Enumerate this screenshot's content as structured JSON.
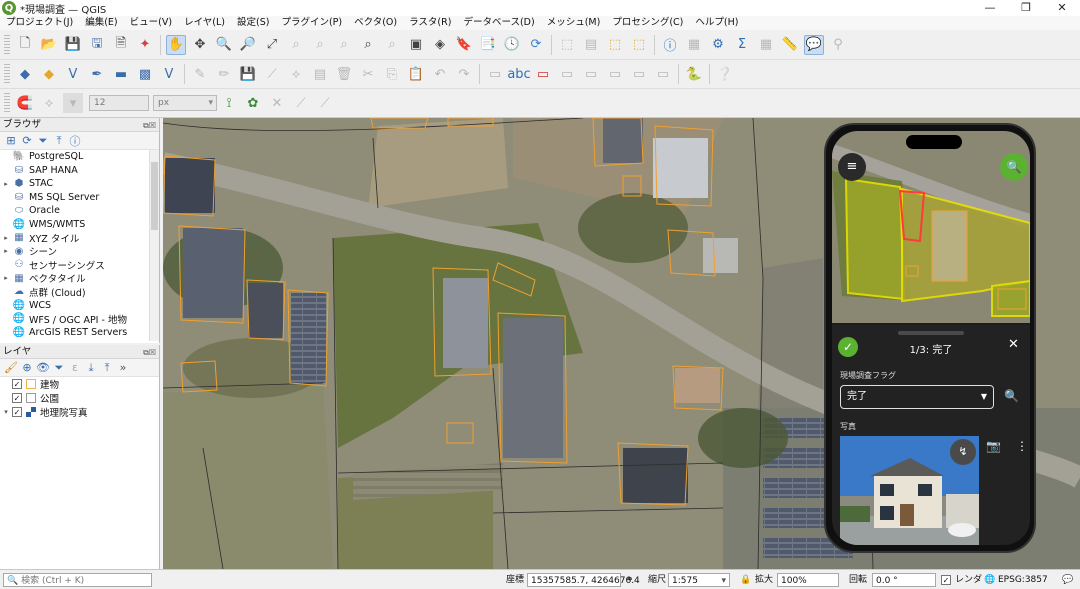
{
  "window": {
    "title": "*現場調査 — QGIS",
    "controls": [
      "—",
      "❐",
      "✕"
    ]
  },
  "menu": [
    "プロジェクト(J)",
    "編集(E)",
    "ビュー(V)",
    "レイヤ(L)",
    "設定(S)",
    "プラグイン(P)",
    "ベクタ(O)",
    "ラスタ(R)",
    "データベース(D)",
    "メッシュ(M)",
    "プロセシング(C)",
    "ヘルプ(H)"
  ],
  "snapping": {
    "tolerance": "12",
    "unit": "px"
  },
  "browser": {
    "title": "ブラウザ",
    "items": [
      {
        "label": "PostgreSQL",
        "icon": "elephant-icon",
        "arrow": ""
      },
      {
        "label": "SAP HANA",
        "icon": "database-icon",
        "arrow": ""
      },
      {
        "label": "STAC",
        "icon": "stac-icon",
        "arrow": "▸"
      },
      {
        "label": "MS SQL Server",
        "icon": "database-icon",
        "arrow": ""
      },
      {
        "label": "Oracle",
        "icon": "database-icon",
        "arrow": ""
      },
      {
        "label": "WMS/WMTS",
        "icon": "globe-icon",
        "arrow": ""
      },
      {
        "label": "XYZ タイル",
        "icon": "grid-icon",
        "arrow": "▸"
      },
      {
        "label": "シーン",
        "icon": "scene-icon",
        "arrow": "▸"
      },
      {
        "label": "センサーシングス",
        "icon": "sensor-icon",
        "arrow": ""
      },
      {
        "label": "ベクタタイル",
        "icon": "grid-icon",
        "arrow": "▸"
      },
      {
        "label": "点群 (Cloud)",
        "icon": "cloud-icon",
        "arrow": ""
      },
      {
        "label": "WCS",
        "icon": "globe-icon",
        "arrow": ""
      },
      {
        "label": "WFS / OGC API - 地物",
        "icon": "globe-icon",
        "arrow": ""
      },
      {
        "label": "ArcGIS REST Servers",
        "icon": "globe-icon",
        "arrow": ""
      }
    ]
  },
  "layers": {
    "title": "レイヤ",
    "items": [
      {
        "label": "建物",
        "checked": "✓",
        "symbol": "#f0b24a",
        "arrow": ""
      },
      {
        "label": "公園",
        "checked": "✓",
        "symbol": "#ffffff",
        "arrow": ""
      },
      {
        "label": "地理院写真",
        "checked": "✓",
        "symbol": "raster",
        "arrow": "▾"
      }
    ]
  },
  "mobile": {
    "record": "1/3: 完了",
    "field_label": "現場調査フラグ",
    "field_value": "完了",
    "photo_label": "写真"
  },
  "status": {
    "search_placeholder": "検索 (Ctrl + K)",
    "coord_label": "座標",
    "coord_value": "15357585.7, 4264676.4",
    "scale_label": "縮尺",
    "scale_value": "1:575",
    "magnifier_label": "拡大",
    "magnifier_value": "100%",
    "rotation_label": "回転",
    "rotation_value": "0.0 °",
    "render_label": "レンダ",
    "crs": "EPSG:3857"
  },
  "colors": {
    "building_outline": "#f0a030",
    "selected_outline": "#ff3a3a",
    "mobile_highlight": "#e8e000",
    "accent_green": "#5ab230"
  }
}
